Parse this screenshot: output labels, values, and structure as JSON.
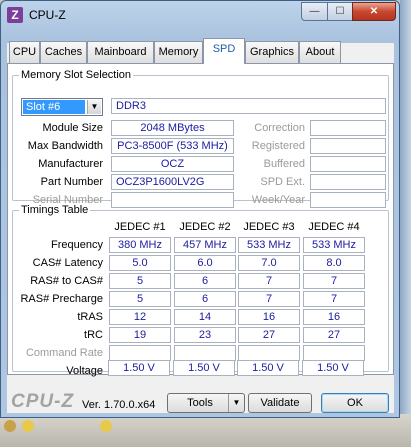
{
  "window": {
    "title": "CPU-Z",
    "app_icon": "Z",
    "close_symbol": "✕",
    "min_symbol": "—",
    "max_symbol": "☐"
  },
  "tabs": [
    {
      "label": "CPU"
    },
    {
      "label": "Caches"
    },
    {
      "label": "Mainboard"
    },
    {
      "label": "Memory"
    },
    {
      "label": "SPD"
    },
    {
      "label": "Graphics"
    },
    {
      "label": "About"
    }
  ],
  "active_tab": "SPD",
  "slot": {
    "group_title": "Memory Slot Selection",
    "selected": "Slot #6",
    "type": "DDR3",
    "rows": [
      {
        "label": "Module Size",
        "value": "2048 MBytes",
        "right_label": "Correction",
        "right_value": ""
      },
      {
        "label": "Max Bandwidth",
        "value": "PC3-8500F (533 MHz)",
        "right_label": "Registered",
        "right_value": ""
      },
      {
        "label": "Manufacturer",
        "value": "OCZ",
        "right_label": "Buffered",
        "right_value": ""
      },
      {
        "label": "Part Number",
        "value": "OCZ3P1600LV2G",
        "right_label": "SPD Ext.",
        "right_value": ""
      },
      {
        "label": "Serial Number",
        "value": "",
        "right_label": "Week/Year",
        "right_value": ""
      }
    ]
  },
  "timings": {
    "group_title": "Timings Table",
    "columns": [
      "JEDEC #1",
      "JEDEC #2",
      "JEDEC #3",
      "JEDEC #4"
    ],
    "rows": [
      {
        "label": "Frequency",
        "values": [
          "380 MHz",
          "457 MHz",
          "533 MHz",
          "533 MHz"
        ]
      },
      {
        "label": "CAS# Latency",
        "values": [
          "5.0",
          "6.0",
          "7.0",
          "8.0"
        ]
      },
      {
        "label": "RAS# to CAS#",
        "values": [
          "5",
          "6",
          "7",
          "7"
        ]
      },
      {
        "label": "RAS# Precharge",
        "values": [
          "5",
          "6",
          "7",
          "7"
        ]
      },
      {
        "label": "tRAS",
        "values": [
          "12",
          "14",
          "16",
          "16"
        ]
      },
      {
        "label": "tRC",
        "values": [
          "19",
          "23",
          "27",
          "27"
        ]
      },
      {
        "label": "Command Rate",
        "values": [
          "",
          "",
          "",
          ""
        ]
      },
      {
        "label": "Voltage",
        "values": [
          "1.50 V",
          "1.50 V",
          "1.50 V",
          "1.50 V"
        ]
      }
    ]
  },
  "footer": {
    "logo": "CPU-Z",
    "version": "Ver. 1.70.0.x64",
    "tools_label": "Tools",
    "validate_label": "Validate",
    "ok_label": "OK"
  },
  "colors": {
    "value_text": "#1b1ba0",
    "selected_slot_bg": "#3399ff",
    "dim_label": "#9b9b9b"
  }
}
